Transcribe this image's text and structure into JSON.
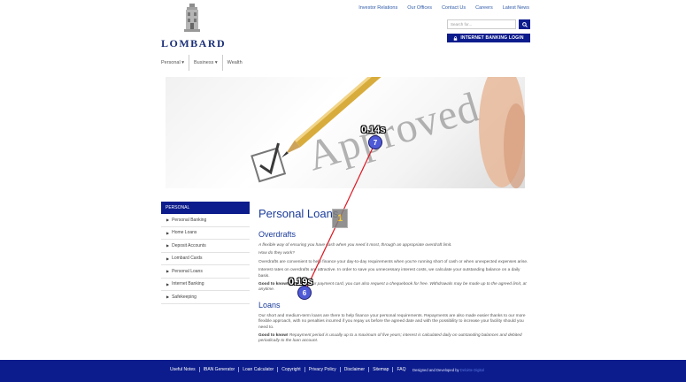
{
  "brand": {
    "name": "LOMBARD"
  },
  "top_links": [
    "Investor Relations",
    "Our Offices",
    "Contact Us",
    "Careers",
    "Latest News"
  ],
  "search": {
    "placeholder": "Search for..."
  },
  "internet_banking_login": "INTERNET BANKING LOGIN",
  "main_nav": [
    "Personal ▾",
    "Business ▾",
    "Wealth"
  ],
  "hero": {
    "image_text": "Approved"
  },
  "sidebar": {
    "header": "PERSONAL",
    "items": [
      "Personal Banking",
      "Home Loans",
      "Deposit Accounts",
      "Lombard Cards",
      "Personal Loans",
      "Internet Banking",
      "Safekeeping"
    ]
  },
  "content": {
    "title": "Personal Loans",
    "overdrafts": {
      "heading": "Overdrafts",
      "intro": "A flexible way of ensuring you have cash when you need it most, through an appropriate overdraft limit.",
      "how": "How do they work?",
      "p1": "Overdrafts are convenient to help finance your day-to-day requirements when you're running short of cash or when unexpected expenses arise.",
      "p2": "Interest rates on overdrafts are attractive. In order to save you unnecessary interest costs, we calculate your outstanding balance on a daily basis.",
      "good_label": "Good to know!",
      "good_text": "On top of your payment card, you can also request a chequebook for free. Withdrawals may be made up to the agreed limit, at anytime."
    },
    "loans": {
      "heading": "Loans",
      "p1": "Our short and medium-term loans are there to help finance your personal requirements. Repayments are also made easier thanks to our more flexible approach, with no penalties incurred if you repay us before the agreed date and with the possibility to increase your facility should you need to.",
      "good_label": "Good to know!",
      "good_text": "Repayment period is usually up to a maximum of five years; interest is calculated daily on outstanding balances and debited periodically to the loan account."
    }
  },
  "overlay": {
    "badge_label": "1",
    "time_top": "0.14s",
    "time_bottom": "0.19s",
    "marker_top": "7",
    "marker_bottom": "6",
    "line_color": "#e0141e"
  },
  "footer": {
    "links": [
      "Useful Notes",
      "IBAN Generator",
      "Loan Calculator",
      "Copyright",
      "Privacy Policy",
      "Disclaimer",
      "Sitemap",
      "FAQ"
    ],
    "credit_prefix": "Designed and Developed by",
    "credit_name": "Deloitte Digital"
  },
  "colors": {
    "brand_blue": "#0c1c8c",
    "heading_blue": "#1a3b9b",
    "link_blue": "#2f5aa8"
  }
}
